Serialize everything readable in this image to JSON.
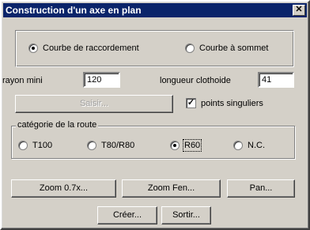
{
  "window": {
    "title": "Construction d'un axe en plan",
    "close_glyph": "✕"
  },
  "curve_type": {
    "options": [
      {
        "label": "Courbe de raccordement",
        "selected": true
      },
      {
        "label": "Courbe à sommet",
        "selected": false
      }
    ]
  },
  "params": {
    "rayon_label": "rayon mini",
    "rayon_value": "120",
    "clothoide_label": "longueur clothoide",
    "clothoide_value": "41"
  },
  "saisir_label": "Saisir...",
  "points_singuliers": {
    "label": "points singuliers",
    "checked": true,
    "check_glyph": "✓"
  },
  "category": {
    "title": "catégorie de la route",
    "options": [
      {
        "label": "T100",
        "selected": false
      },
      {
        "label": "T80/R80",
        "selected": false
      },
      {
        "label": "R60",
        "selected": true
      },
      {
        "label": "N.C.",
        "selected": false
      }
    ]
  },
  "buttons": {
    "zoom": "Zoom 0.7x...",
    "zoom_fen": "Zoom Fen...",
    "pan": "Pan...",
    "creer": "Créer...",
    "sortir": "Sortir..."
  }
}
